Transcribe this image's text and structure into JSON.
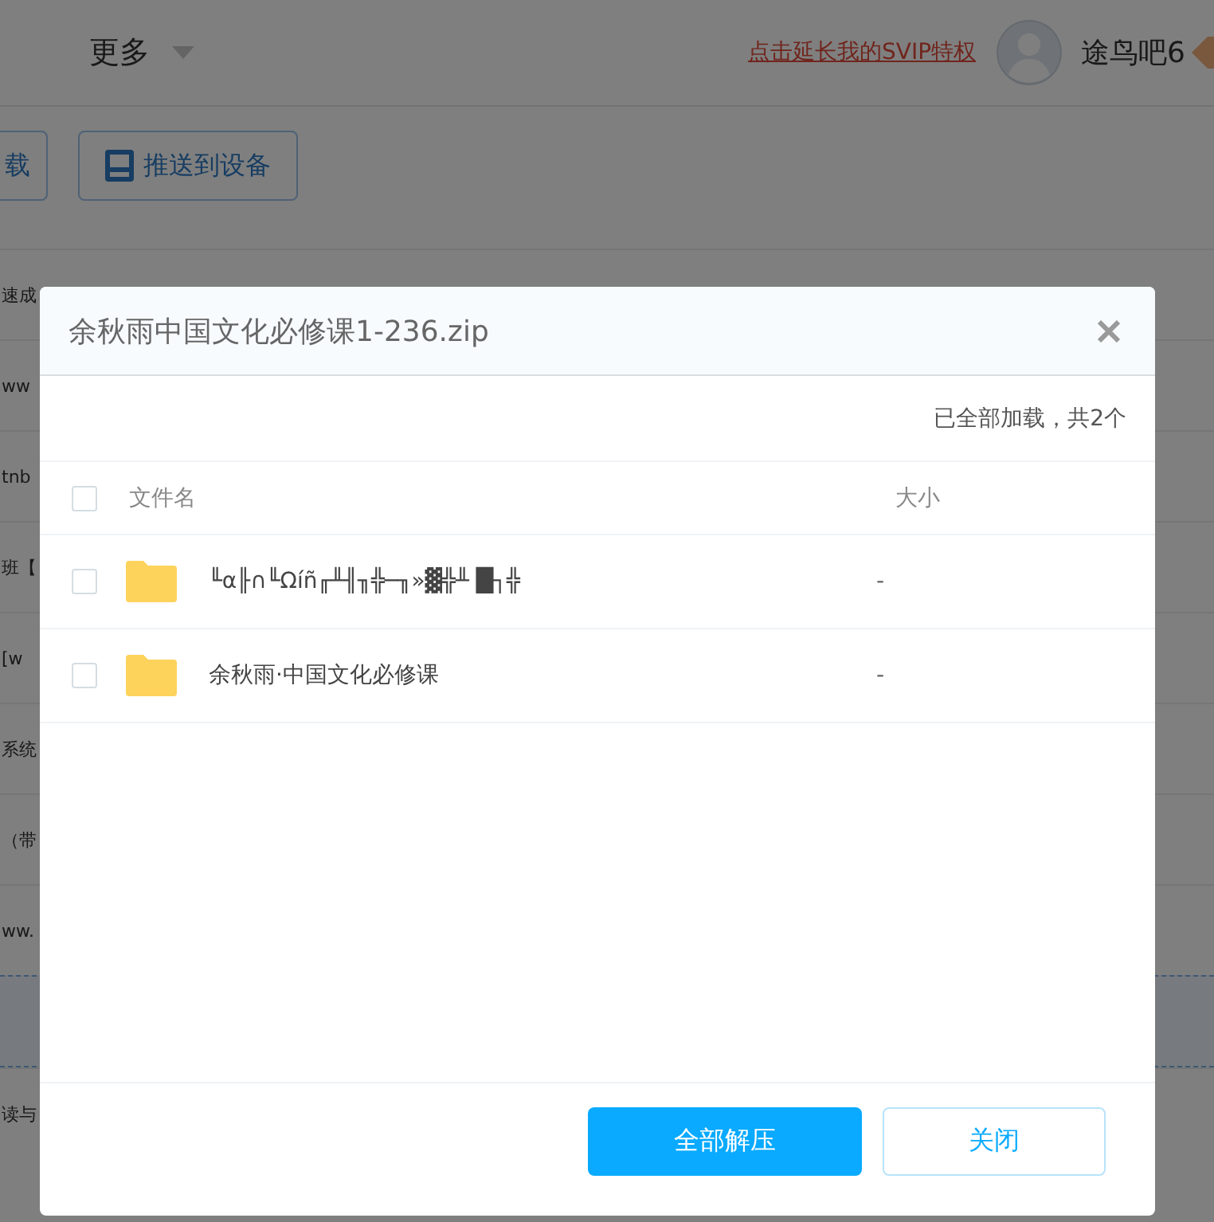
{
  "header": {
    "menu": "更多",
    "svip_link": "点击延长我的SVIP特权",
    "username": "途鸟吧6"
  },
  "toolbar": {
    "buttons": [
      {
        "label": "载",
        "kind": "plain"
      },
      {
        "label": "推送到设备",
        "kind": "device"
      }
    ]
  },
  "background_rows": [
    {
      "text": "速成"
    },
    {
      "text": "ww"
    },
    {
      "text": "tnb"
    },
    {
      "text": "班【"
    },
    {
      "text": "[w"
    },
    {
      "text": "系统"
    },
    {
      "text": "（带"
    },
    {
      "text": "ww."
    },
    {
      "text": ""
    },
    {
      "text": "读与"
    }
  ],
  "dialog": {
    "title": "余秋雨中国文化必修课1-236.zip",
    "status": "已全部加载，共2个",
    "select_all": {
      "checked": false
    },
    "columns": [
      "文件名",
      "大小"
    ],
    "files": [
      {
        "name": "╙α╟∩╙Ωíñ╓╨╢╖╬─╖»▓╬╨ █┐╬",
        "size": "-",
        "checked": false
      },
      {
        "name": "余秋雨·中国文化必修课",
        "size": "-",
        "checked": false
      }
    ],
    "buttons": [
      {
        "label": "全部解压",
        "kind": "primary"
      },
      {
        "label": "关闭",
        "kind": "secondary"
      }
    ]
  }
}
